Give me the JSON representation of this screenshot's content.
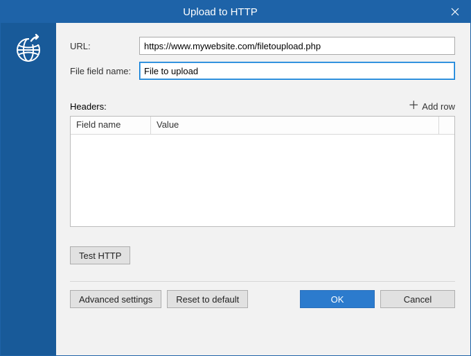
{
  "title": "Upload to HTTP",
  "labels": {
    "url": "URL:",
    "fileField": "File field name:",
    "headers": "Headers:",
    "addRow": "Add row"
  },
  "inputs": {
    "url": "https://www.mywebsite.com/filetoupload.php",
    "fileField": "File to upload"
  },
  "table": {
    "colFieldName": "Field name",
    "colValue": "Value"
  },
  "buttons": {
    "testHttp": "Test HTTP",
    "advanced": "Advanced settings",
    "reset": "Reset to default",
    "ok": "OK",
    "cancel": "Cancel"
  }
}
